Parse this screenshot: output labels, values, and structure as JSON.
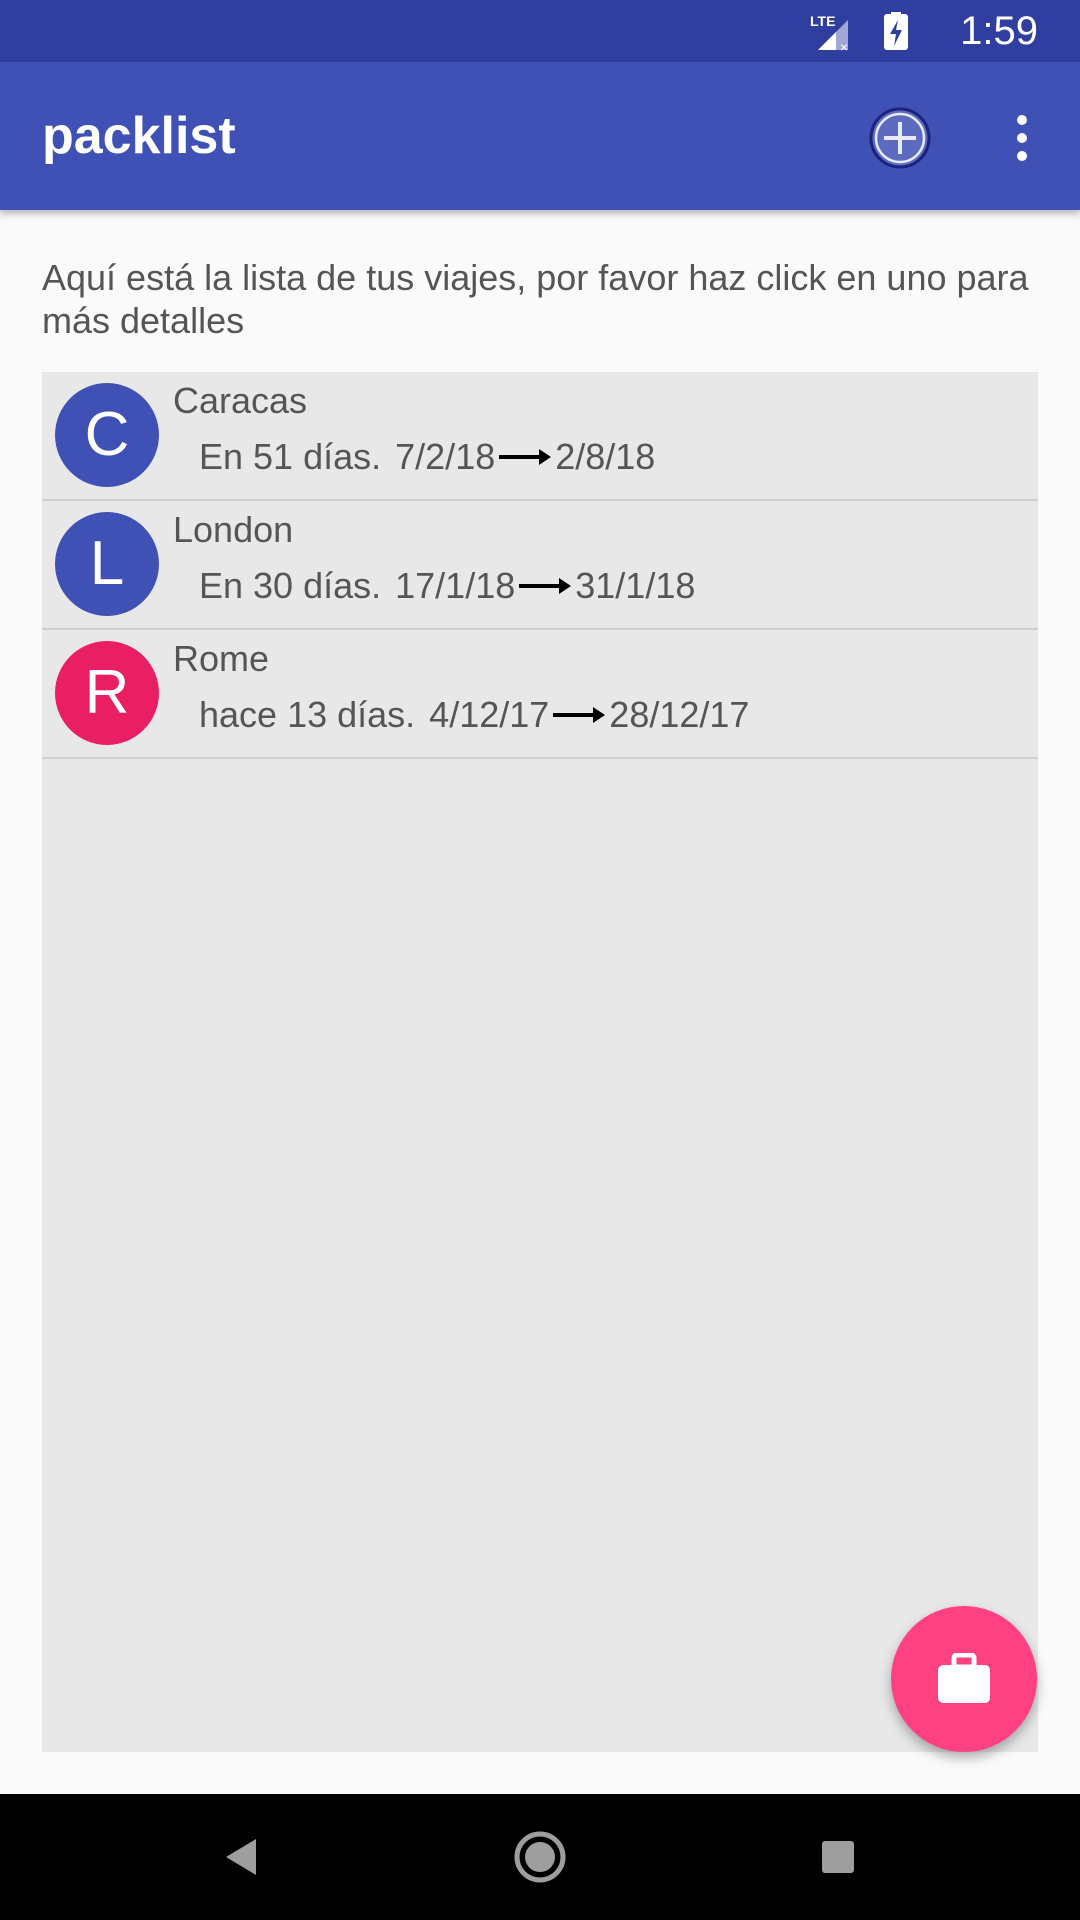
{
  "status_bar": {
    "time": "1:59",
    "network": "LTE",
    "icons": [
      "lte-signal-icon",
      "battery-charging-icon"
    ]
  },
  "app_bar": {
    "title": "packlist",
    "actions": [
      "add-circle-icon",
      "more-vert-icon"
    ],
    "color": "#3f51b5"
  },
  "intro_text": "Aquí está la lista de tus viajes, por favor haz click en uno para más detalles",
  "trips": [
    {
      "initial": "C",
      "name": "Caracas",
      "relative": "En 51 días.",
      "start": "7/2/18",
      "end": "2/8/18",
      "avatar_color": "#3f51b5"
    },
    {
      "initial": "L",
      "name": "London",
      "relative": "En 30 días.",
      "start": "17/1/18",
      "end": "31/1/18",
      "avatar_color": "#3f51b5"
    },
    {
      "initial": "R",
      "name": "Rome",
      "relative": "hace 13 días.",
      "start": "4/12/17",
      "end": "28/12/17",
      "avatar_color": "#e91e63"
    }
  ],
  "fab": {
    "icon": "briefcase-icon",
    "color": "#ff4081"
  },
  "nav_bar": {
    "buttons": [
      "back-icon",
      "home-icon",
      "recents-icon"
    ]
  }
}
